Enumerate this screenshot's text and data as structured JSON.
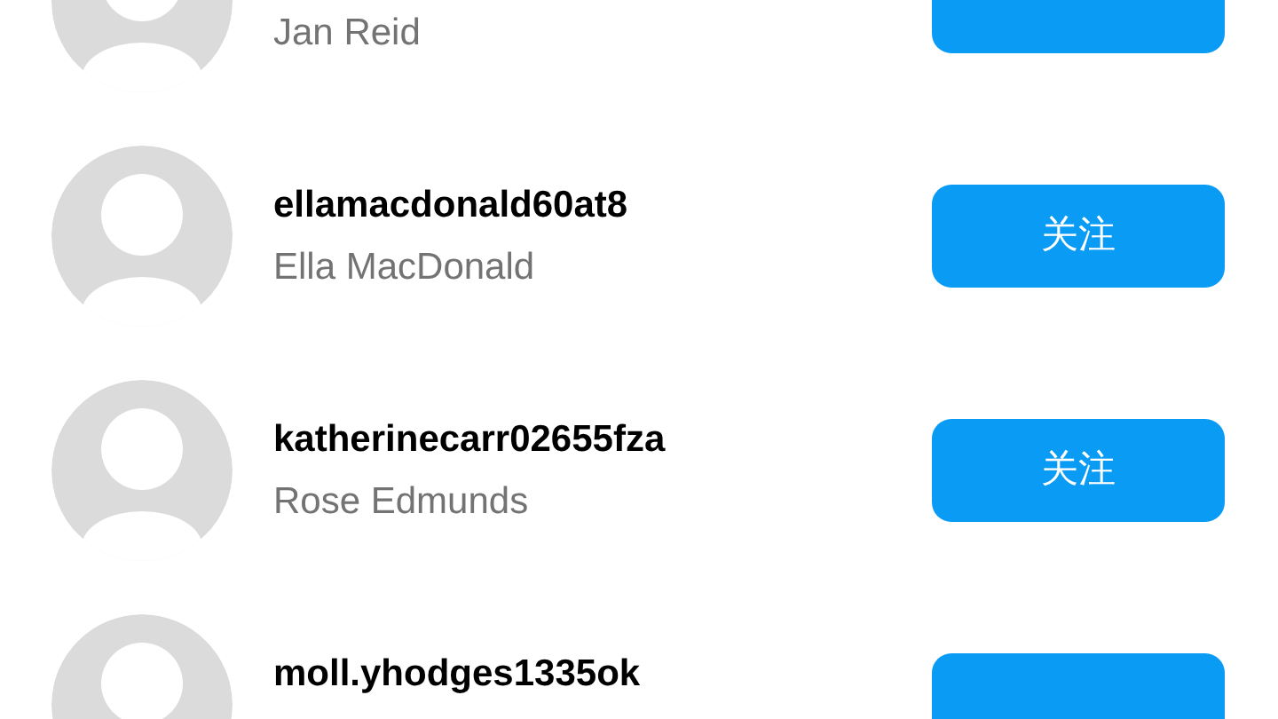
{
  "users": [
    {
      "display_name": "Jan Reid",
      "button": true
    },
    {
      "username": "ellamacdonald60at8",
      "display_name": "Ella MacDonald",
      "button": true,
      "button_label": "关注"
    },
    {
      "username": "katherinecarr02655fza",
      "display_name": "Rose Edmunds",
      "button": true,
      "button_label": "关注"
    },
    {
      "username": "moll.yhodges1335ok",
      "button": true
    }
  ]
}
